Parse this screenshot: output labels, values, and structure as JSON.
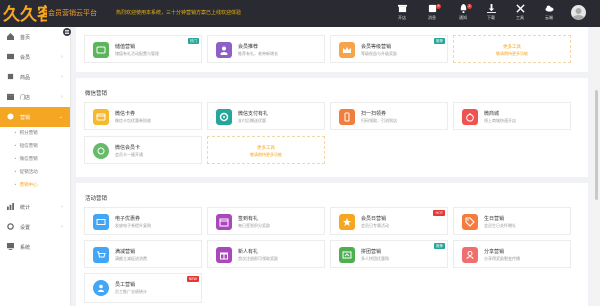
{
  "header": {
    "brand": "会员营销云平台",
    "notice": "热烈欢迎使用本系统，三十分钟营销方案已上线欢迎体验",
    "buttons": [
      {
        "label": "开店",
        "icon": "store-icon"
      },
      {
        "label": "消息",
        "icon": "message-icon",
        "badge": "9"
      },
      {
        "label": "通知",
        "icon": "bell-icon",
        "badge": "2"
      },
      {
        "label": "下载",
        "icon": "download-icon"
      },
      {
        "label": "工具",
        "icon": "tools-icon"
      },
      {
        "label": "云端",
        "icon": "cloud-icon"
      }
    ]
  },
  "sidebar": {
    "items": [
      {
        "label": "首页",
        "icon": "home-icon"
      },
      {
        "label": "会员",
        "icon": "member-icon",
        "arrow": "›"
      },
      {
        "label": "商品",
        "icon": "goods-icon",
        "arrow": "›"
      },
      {
        "label": "门店",
        "icon": "shop-icon",
        "arrow": "›"
      },
      {
        "label": "营销",
        "icon": "marketing-icon",
        "arrow": "⌄",
        "active": true
      },
      {
        "label": "统计",
        "icon": "stats-icon",
        "arrow": "›"
      },
      {
        "label": "设置",
        "icon": "settings-icon",
        "arrow": "›"
      },
      {
        "label": "系统",
        "icon": "system-icon"
      }
    ],
    "sub_items": [
      {
        "label": "积分营销"
      },
      {
        "label": "短信营销"
      },
      {
        "label": "微信营销"
      },
      {
        "label": "促销活动"
      },
      {
        "label": "营销中心",
        "active": true
      }
    ]
  },
  "sections": {
    "top": {
      "cards": [
        {
          "title": "储值营销",
          "desc": "储值有礼活动配置与管理",
          "color": "#5bb55a",
          "icon": "wallet-icon",
          "tag": "热门",
          "tag_color": "#26a69a"
        },
        {
          "title": "会员推荐",
          "desc": "推荐有礼，老带新增长",
          "color": "#8e5fc7",
          "icon": "user-plus-icon"
        },
        {
          "title": "会员等级营销",
          "desc": "等级权益与升级奖励",
          "color": "#f7a34a",
          "icon": "crown-icon",
          "tag": "推荐",
          "tag_color": "#26a69a"
        }
      ],
      "more": {
        "title": "更多工具",
        "desc": "敬请期待更多功能"
      }
    },
    "wechat": {
      "title": "微信营销",
      "cards": [
        {
          "title": "微信卡券",
          "desc": "微信卡包优惠券投放",
          "color": "#f5b82e",
          "icon": "card-icon"
        },
        {
          "title": "微信支付有礼",
          "desc": "支付后赠送优惠",
          "color": "#26a69a",
          "icon": "gear-icon"
        },
        {
          "title": "扫一扫领券",
          "desc": "扫码领取，引流到店",
          "color": "#f07e3c",
          "icon": "phone-icon"
        },
        {
          "title": "微商城",
          "desc": "线上商城快速开店",
          "color": "#ef5350",
          "icon": "apple-icon"
        },
        {
          "title": "微信会员卡",
          "desc": "会员卡一键开通",
          "color": "#66bb6a",
          "icon": "member-card-icon"
        }
      ],
      "more": {
        "title": "更多工具",
        "desc": "敬请期待更多功能"
      }
    },
    "activity": {
      "title": "活动营销",
      "cards": [
        {
          "title": "电子优惠券",
          "desc": "发放电子券提升复购",
          "color": "#42a5f5",
          "icon": "coupon-icon"
        },
        {
          "title": "签到有礼",
          "desc": "每日签到积分奖励",
          "color": "#ab47bc",
          "icon": "calendar-icon"
        },
        {
          "title": "会员日营销",
          "desc": "会员日专属活动",
          "color": "#f5a623",
          "icon": "star-icon",
          "tag": "HOT",
          "tag_color": "#e53935"
        },
        {
          "title": "生日营销",
          "desc": "会员生日关怀赠礼",
          "color": "#f57c3c",
          "icon": "tag-icon"
        },
        {
          "title": "满减营销",
          "desc": "满额立减促进消费",
          "color": "#42a5f5",
          "icon": "cart-icon"
        },
        {
          "title": "新人有礼",
          "desc": "首次注册即可领取奖励",
          "color": "#ab47bc",
          "icon": "gift-icon"
        },
        {
          "title": "拼团营销",
          "desc": "多人拼团优惠购",
          "color": "#4caf50",
          "icon": "group-icon",
          "tag": "推荐",
          "tag_color": "#26a69a"
        },
        {
          "title": "分享营销",
          "desc": "分享得奖励裂变传播",
          "color": "#ef6f6f",
          "icon": "share-icon"
        },
        {
          "title": "员工营销",
          "desc": "员工推广业绩统计",
          "color": "#42a5f5",
          "icon": "staff-icon",
          "tag": "NEW",
          "tag_color": "#e53935"
        }
      ]
    }
  }
}
